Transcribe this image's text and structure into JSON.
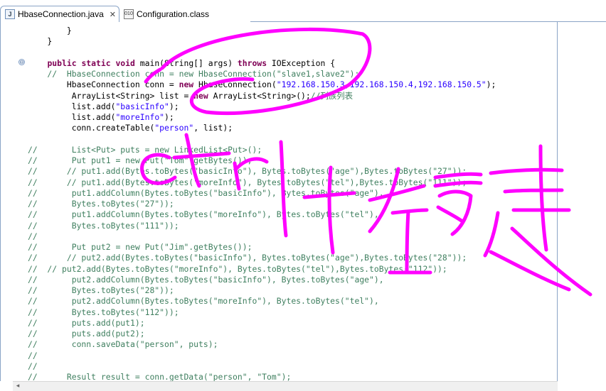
{
  "tabs": [
    {
      "label": "HbaseConnection.java",
      "close": "✕",
      "icon": "java-file-icon",
      "active": true
    },
    {
      "label": "Configuration.class",
      "icon": "class-file-icon",
      "active": false
    }
  ],
  "code_lines": [
    [
      {
        "t": "        }",
        "c": ""
      }
    ],
    [
      {
        "t": "    }",
        "c": ""
      }
    ],
    [
      {
        "t": "",
        "c": ""
      }
    ],
    [
      {
        "t": "    ",
        "c": ""
      },
      {
        "t": "public static void",
        "c": "kw"
      },
      {
        "t": " main(String[] args) ",
        "c": ""
      },
      {
        "t": "throws",
        "c": "kw"
      },
      {
        "t": " IOException {",
        "c": ""
      }
    ],
    [
      {
        "t": "    //  HbaseConnection conn = new HbaseConnection(\"slave1,slave2\");",
        "c": "cmt"
      }
    ],
    [
      {
        "t": "        HbaseConnection conn = ",
        "c": ""
      },
      {
        "t": "new",
        "c": "kw"
      },
      {
        "t": " HbaseConnection(",
        "c": ""
      },
      {
        "t": "\"192.168.150.3,192.168.150.4,192.168.150.5\"",
        "c": "str"
      },
      {
        "t": ");",
        "c": ""
      }
    ],
    [
      {
        "t": "         ArrayList<String> list = ",
        "c": ""
      },
      {
        "t": "new",
        "c": "kw"
      },
      {
        "t": " ArrayList<String>();",
        "c": ""
      },
      {
        "t": "//列族列表",
        "c": "cmt"
      }
    ],
    [
      {
        "t": "         list.add(",
        "c": ""
      },
      {
        "t": "\"basicInfo\"",
        "c": "str"
      },
      {
        "t": ");",
        "c": ""
      }
    ],
    [
      {
        "t": "         list.add(",
        "c": ""
      },
      {
        "t": "\"moreInfo\"",
        "c": "str"
      },
      {
        "t": ");",
        "c": ""
      }
    ],
    [
      {
        "t": "         conn.createTable(",
        "c": ""
      },
      {
        "t": "\"person\"",
        "c": "str"
      },
      {
        "t": ", list);",
        "c": ""
      }
    ],
    [
      {
        "t": "",
        "c": ""
      }
    ],
    [
      {
        "t": "//       List<Put> puts = new LinkedList<Put>();",
        "c": "cmt"
      }
    ],
    [
      {
        "t": "//       Put put1 = new Put(\"Tom\".getBytes());",
        "c": "cmt"
      }
    ],
    [
      {
        "t": "//      // put1.add(Bytes.toBytes(\"basicInfo\"), Bytes.toBytes(\"age\"),Bytes.toBytes(\"27\"));",
        "c": "cmt"
      }
    ],
    [
      {
        "t": "//      // put1.add(Bytes.toBytes(\"moreInfo\"), Bytes.toBytes(\"tel\"),Bytes.toBytes(\"111\"));",
        "c": "cmt"
      }
    ],
    [
      {
        "t": "//       put1.addColumn(Bytes.toBytes(\"basicInfo\"), Bytes.toBytes(\"age\"),",
        "c": "cmt"
      }
    ],
    [
      {
        "t": "//       Bytes.toBytes(\"27\"));",
        "c": "cmt"
      }
    ],
    [
      {
        "t": "//       put1.addColumn(Bytes.toBytes(\"moreInfo\"), Bytes.toBytes(\"tel\"),",
        "c": "cmt"
      }
    ],
    [
      {
        "t": "//       Bytes.toBytes(\"111\"));",
        "c": "cmt"
      }
    ],
    [
      {
        "t": "//",
        "c": "cmt"
      }
    ],
    [
      {
        "t": "//       Put put2 = new Put(\"Jim\".getBytes());",
        "c": "cmt"
      }
    ],
    [
      {
        "t": "//      // put2.add(Bytes.toBytes(\"basicInfo\"), Bytes.toBytes(\"age\"),Bytes.toBytes(\"28\"));",
        "c": "cmt"
      }
    ],
    [
      {
        "t": "//  // put2.add(Bytes.toBytes(\"moreInfo\"), Bytes.toBytes(\"tel\"),Bytes.toBytes(\"112\"));",
        "c": "cmt"
      }
    ],
    [
      {
        "t": "//       put2.addColumn(Bytes.toBytes(\"basicInfo\"), Bytes.toBytes(\"age\"),",
        "c": "cmt"
      }
    ],
    [
      {
        "t": "//       Bytes.toBytes(\"28\"));",
        "c": "cmt"
      }
    ],
    [
      {
        "t": "//       put2.addColumn(Bytes.toBytes(\"moreInfo\"), Bytes.toBytes(\"tel\"),",
        "c": "cmt"
      }
    ],
    [
      {
        "t": "//       Bytes.toBytes(\"112\"));",
        "c": "cmt"
      }
    ],
    [
      {
        "t": "//       puts.add(put1);",
        "c": "cmt"
      }
    ],
    [
      {
        "t": "//       puts.add(put2);",
        "c": "cmt"
      }
    ],
    [
      {
        "t": "//       conn.saveData(\"person\", puts);",
        "c": "cmt"
      }
    ],
    [
      {
        "t": "//",
        "c": "cmt"
      }
    ],
    [
      {
        "t": "//",
        "c": "cmt"
      }
    ],
    [
      {
        "t": "//      Result result = conn.getData(\"person\", \"Tom\");",
        "c": "cmt"
      }
    ]
  ],
  "fold_markers": [
    "⊖"
  ],
  "annotation": {
    "text": "ctrl+左鍵",
    "color": "#ff00ff"
  },
  "colors": {
    "keyword": "#7f0055",
    "string": "#2a00ff",
    "comment": "#3f7f5f",
    "annotation": "#ff00ff"
  },
  "scrollbar_arrow": "◂"
}
